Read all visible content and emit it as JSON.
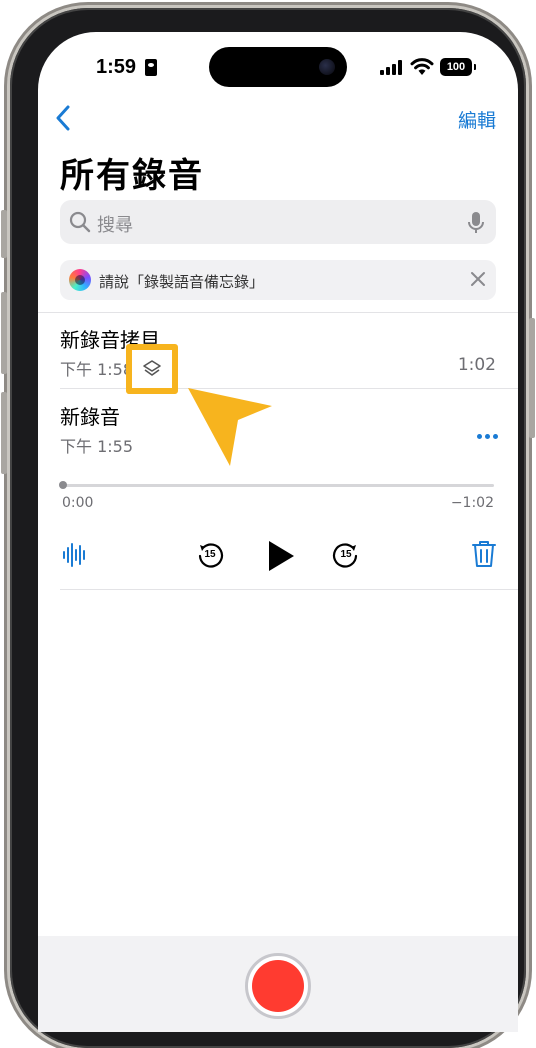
{
  "status_bar": {
    "time": "1:59",
    "battery": "100"
  },
  "nav": {
    "edit_label": "編輯"
  },
  "page": {
    "title": "所有錄音"
  },
  "search": {
    "placeholder": "搜尋"
  },
  "siri": {
    "suggestion": "請說「錄製語音備忘錄」"
  },
  "recordings": [
    {
      "name": "新錄音拷貝",
      "time": "下午 1:58",
      "duration": "1:02"
    },
    {
      "name": "新錄音",
      "time": "下午 1:55",
      "duration": ""
    }
  ],
  "player": {
    "elapsed": "0:00",
    "remaining": "−1:02",
    "position": 0.0,
    "skip_back_seconds": "15",
    "skip_forward_seconds": "15"
  },
  "icons": {
    "back": "chevron-left-icon",
    "search": "search-icon",
    "mic": "microphone-icon",
    "siri": "siri-orb-icon",
    "close": "close-icon",
    "copy": "layers-icon",
    "more": "ellipsis-icon",
    "waveform": "waveform-icon",
    "skip_back": "skip-back-15-icon",
    "play": "play-icon",
    "skip_forward": "skip-forward-15-icon",
    "trash": "trash-icon",
    "record": "record-icon"
  },
  "colors": {
    "accent": "#1a7bd4",
    "record": "#ff3b30",
    "highlight": "#f7b41e"
  }
}
